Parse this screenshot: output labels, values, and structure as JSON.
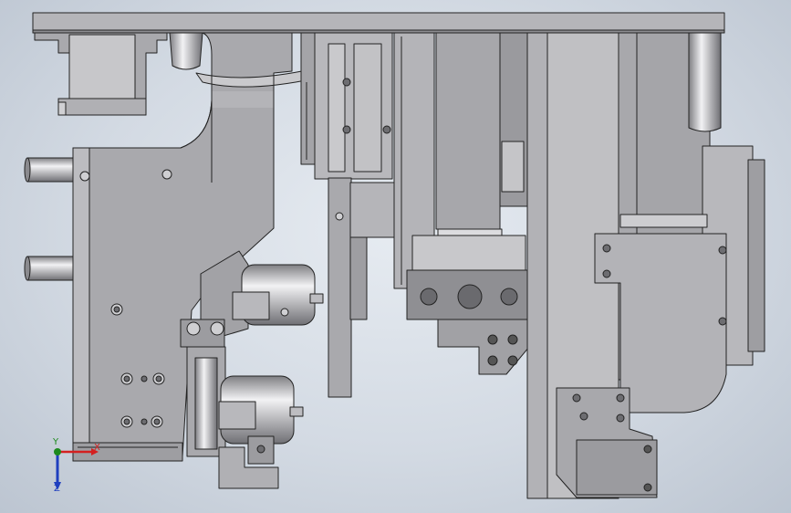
{
  "triad": {
    "x_label": "X",
    "y_label": "Y",
    "z_label": "Z"
  },
  "colors": {
    "background": "#d3dae3",
    "part_face": "#a9a9ad",
    "part_light": "#c4c4c7",
    "part_dark": "#8c8c90",
    "edge": "#232323",
    "axis_x": "#d42020",
    "axis_y": "#1d8a1d",
    "axis_z": "#1f3fbf"
  }
}
